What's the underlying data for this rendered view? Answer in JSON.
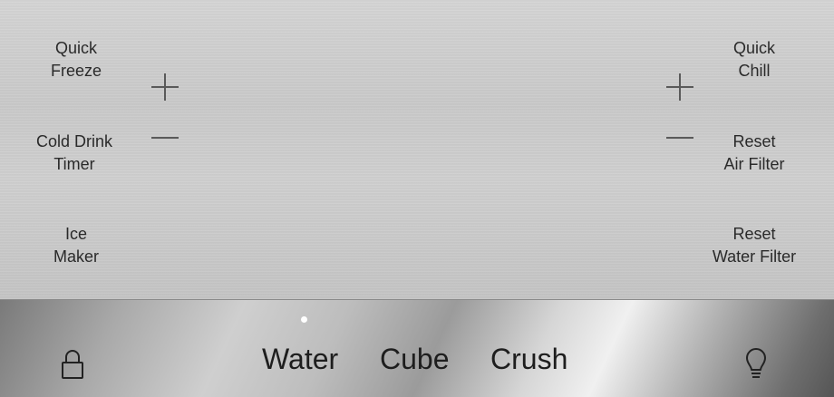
{
  "left_buttons": {
    "quick_freeze": [
      "Quick",
      "Freeze"
    ],
    "cold_drink_timer": [
      "Cold Drink",
      "Timer"
    ],
    "ice_maker": [
      "Ice",
      "Maker"
    ]
  },
  "right_buttons": {
    "quick_chill": [
      "Quick",
      "Chill"
    ],
    "reset_air_filter": [
      "Reset",
      "Air Filter"
    ],
    "reset_water_filter": [
      "Reset",
      "Water Filter"
    ]
  },
  "dispenser": {
    "water": "Water",
    "cube": "Cube",
    "crush": "Crush",
    "selected": "Water"
  },
  "icons": {
    "lock": "lock-icon",
    "light": "light-bulb-icon",
    "plus": "plus-icon",
    "minus": "minus-icon"
  },
  "colors": {
    "text": "#2a2a2a",
    "indicator": "#ffffff"
  }
}
